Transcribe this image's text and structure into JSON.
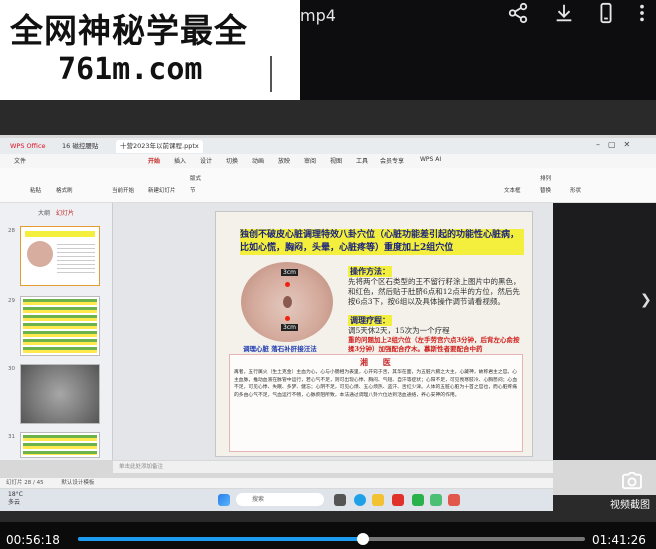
{
  "header": {
    "watermark_line1": "全网神秘学最全",
    "watermark_line2": "761m.com",
    "video_title_suffix": "mp4"
  },
  "wps": {
    "tabs": [
      {
        "label": "WPS Office"
      },
      {
        "label": "16 磁控腰贴"
      },
      {
        "label": "十营2023年以前课程.pptx"
      }
    ],
    "menu": [
      "文件",
      "开始",
      "插入",
      "设计",
      "切换",
      "动画",
      "放映",
      "审阅",
      "视图",
      "工具",
      "会员专享",
      "WPS AI"
    ],
    "ribbon": [
      "格式刷",
      "粘贴",
      "当前开始",
      "新建幻灯片",
      "版式",
      "节",
      "排列",
      "替换",
      "文本框",
      "形状"
    ],
    "left_tabs": [
      "大纲",
      "幻灯片"
    ],
    "thumb_numbers": [
      "28",
      "29",
      "30",
      "31"
    ],
    "notes_placeholder": "单击此处添加备注",
    "status_left": "幻灯片 28 / 45",
    "status_theme": "默认设计模板",
    "taskbar_search": "搜索",
    "weather": "18°C",
    "weather_desc": "多云"
  },
  "slide": {
    "title": "独创不破皮心脏调理特效八卦穴位（心脏功能差引起的功能性心脏病，比如心慌，胸闷，头晕，心脏疼等）重度加上2组穴位",
    "image_label_top": "3cm",
    "image_label_bottom": "3cm",
    "image_caption": "调理心脏  落石补肝接汪法",
    "method_heading": "操作方法：",
    "method_text": "先将两个区石类型的王不留行籽涂上图片中的黑色，和红色，然后贴于肚脐6点和12点半的方位，然后先按6点3下，按6组以及具体操作调节请看视频。",
    "course_heading": "调理疗程：",
    "course_text": "调5天休2天，15次为一个疗程",
    "severe_text": "重的问题加上2组穴位（左手劳宫穴点3分钟，后背左心俞按揉3分钟）加强配合疗木。慕斯性者要配合中药",
    "panel_title": "湘 医",
    "panel_text": "再者，五行属火（生土克金）主血为心，心与小肠相为表里，心开窍于舌，其华在面，为五脏六腑之大主，心藏神，故称君主之官。心主血脉，推动血液在脉管中运行，若心气不足，则可出现心悸、胸闷、气短、自汗等症状；心阳不足，可见畏寒肢冷、心胸憋闷；心血不足，可见心悸、失眠、多梦、健忘；心阴不足，可见心烦、五心烦热、盗汗、舌红少津。人体的五脏心脏为十首之官也，而心脏疼痛的多由心气不足，气血运行不畅，心脉瘀阻所致，本法通过调理八卦穴位达到活血通络，养心安神的作用。"
  },
  "player": {
    "screenshot_label": "视频截图",
    "current_time": "00:56:18",
    "total_time": "01:41:26",
    "progress": 0.563,
    "accent": "#1d9bf0"
  }
}
